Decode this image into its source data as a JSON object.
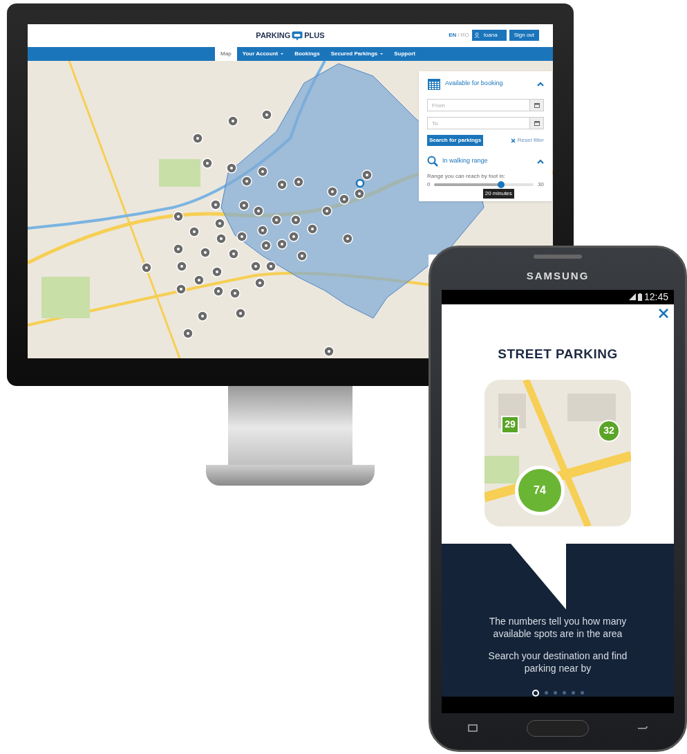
{
  "website": {
    "logo": {
      "left": "PARKING",
      "right": "PLUS"
    },
    "language": {
      "options": [
        {
          "label": "EN",
          "selected": true
        },
        {
          "label": "RO",
          "selected": false
        }
      ],
      "separator": "/"
    },
    "user_button": "Ioana",
    "sign_out_button": "Sign out",
    "nav": [
      {
        "label": "Map",
        "selected": true,
        "dropdown": false
      },
      {
        "label": "Your Account",
        "selected": false,
        "dropdown": true
      },
      {
        "label": "Bookings",
        "selected": false,
        "dropdown": false
      },
      {
        "label": "Secured Parkings",
        "selected": false,
        "dropdown": true
      },
      {
        "label": "Support",
        "selected": false,
        "dropdown": false
      }
    ],
    "booking_panel": {
      "title": "Available for booking",
      "expanded": true,
      "from": {
        "placeholder": "From"
      },
      "to": {
        "placeholder": "To"
      },
      "search_button": "Search for parkings",
      "reset_button": "Reset filter"
    },
    "walking_panel": {
      "title": "In walking range",
      "expanded": true,
      "range_label": "Range you can reach by foot in:",
      "min": "0",
      "max": "30",
      "level": 0.67,
      "tooltip": "20 minutes"
    }
  },
  "phone": {
    "brand": "SAMSUNG",
    "time": "12:45",
    "title": "STREET PARKING",
    "badges": [
      {
        "label": "29"
      },
      {
        "label": "32"
      },
      {
        "label": "74"
      }
    ],
    "paragraphs": [
      "The numbers tell you how many available spots are in the area",
      "Search your destination and find parking near by"
    ],
    "pages": [
      {
        "selected": true
      },
      {
        "selected": false
      },
      {
        "selected": false
      },
      {
        "selected": false
      },
      {
        "selected": false
      },
      {
        "selected": false
      }
    ]
  }
}
